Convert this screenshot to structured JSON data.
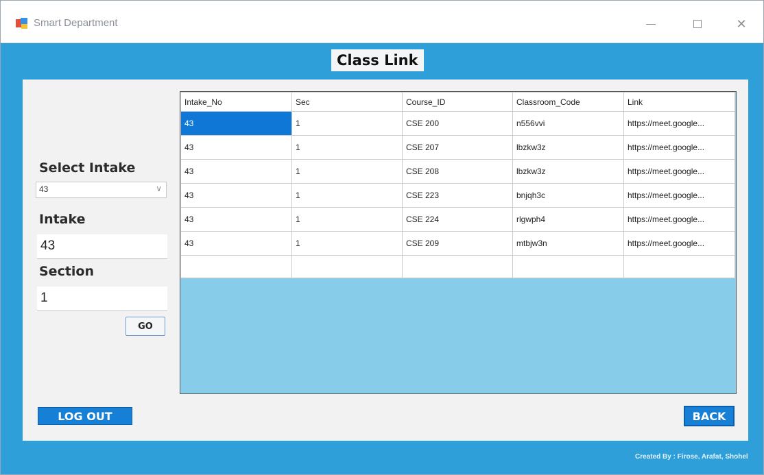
{
  "window": {
    "title": "Smart Department",
    "minimize_icon": "minimize-icon",
    "maximize_icon": "maximize-icon",
    "close_icon": "close-icon",
    "close_glyph": "✕"
  },
  "header": {
    "title": "Class Link"
  },
  "filters": {
    "select_intake_label": "Select Intake",
    "select_intake_value": "43",
    "intake_label": "Intake",
    "intake_value": "43",
    "section_label": "Section",
    "section_value": "1",
    "go_label": "GO"
  },
  "table": {
    "columns": [
      "Intake_No",
      "Sec",
      "Course_ID",
      "Classroom_Code",
      "Link"
    ],
    "rows": [
      [
        "43",
        "1",
        "CSE 200",
        "n556vvi",
        "https://meet.google..."
      ],
      [
        "43",
        "1",
        "CSE 207",
        "lbzkw3z",
        "https://meet.google..."
      ],
      [
        "43",
        "1",
        "CSE 208",
        "lbzkw3z",
        "https://meet.google..."
      ],
      [
        "43",
        "1",
        "CSE 223",
        "bnjqh3c",
        "https://meet.google..."
      ],
      [
        "43",
        "1",
        "CSE 224",
        "rlgwph4",
        "https://meet.google..."
      ],
      [
        "43",
        "1",
        "CSE 209",
        "mtbjw3n",
        "https://meet.google..."
      ]
    ]
  },
  "footer": {
    "logout_label": "LOG OUT",
    "back_label": "BACK",
    "credits": "Created By : Firose, Arafat, Shohel"
  },
  "colors": {
    "window_bg": "#2f9fd9",
    "grid_bg": "#87cdea",
    "selection": "#0f78d7",
    "button": "#1680d6"
  }
}
